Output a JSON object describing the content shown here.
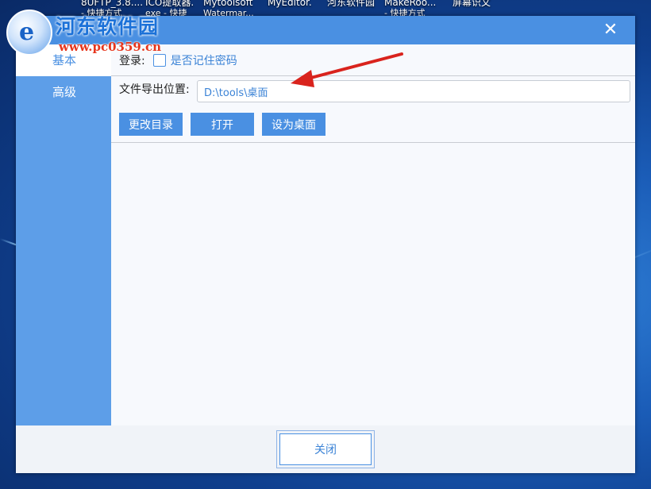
{
  "desktop": {
    "icons": [
      {
        "label": "8UFTP_3.8....",
        "sub": "- 快捷方式"
      },
      {
        "label": "ICO提取器.",
        "sub": "exe - 快捷"
      },
      {
        "label": "Mytoolsoft",
        "sub": "Watermar..."
      },
      {
        "label": "MyEditor.",
        "sub": ""
      },
      {
        "label": "河东软件园",
        "sub": ""
      },
      {
        "label": "MakeRoo...",
        "sub": "- 快捷方式"
      },
      {
        "label": "屏幕识文",
        "sub": ""
      }
    ]
  },
  "watermark": {
    "title": "河东软件园",
    "url": "www.pc0359.cn"
  },
  "window": {
    "close_glyph": "✕",
    "sidebar": {
      "items": [
        {
          "label": "基本"
        },
        {
          "label": "高级"
        }
      ]
    },
    "login_label": "登录:",
    "remember_label": "是否记住密码",
    "export_label": "文件导出位置:",
    "export_path": "D:\\tools\\桌面",
    "buttons": {
      "change_dir": "更改目录",
      "open": "打开",
      "set_desktop": "设为桌面"
    },
    "footer_close": "关闭"
  },
  "colors": {
    "accent": "#4a90e2",
    "sidebar": "#5d9ee8",
    "arrow": "#d9231d"
  }
}
